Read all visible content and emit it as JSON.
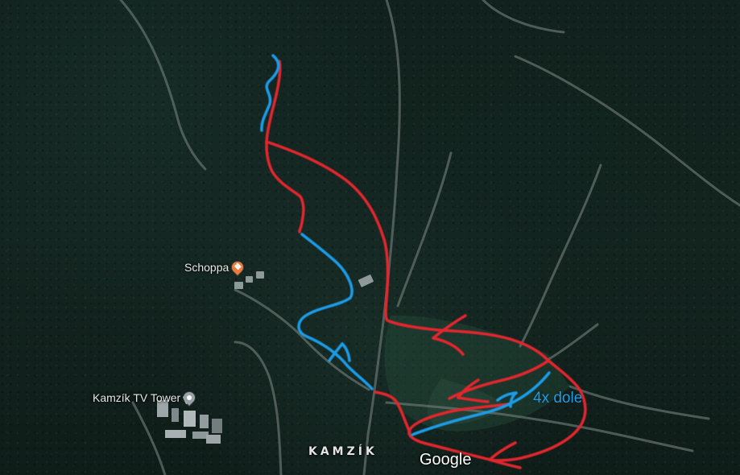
{
  "map": {
    "colors": {
      "background": "#13241f",
      "road": "#6f7a75",
      "route_red": "#e3252d",
      "route_blue": "#1f9ce8",
      "poi_orange": "#f07a3c",
      "poi_gray": "#9aa1a7",
      "clearing": "#2d5d45"
    },
    "labels": {
      "restaurant": "Schoppa",
      "landmark": "Kamzík TV Tower",
      "place": "KAMZÍK",
      "route_note": "4x dole",
      "logo": "Google"
    },
    "icons": {
      "restaurant": "restaurant-pin-icon",
      "landmark": "landmark-pin-icon"
    }
  }
}
